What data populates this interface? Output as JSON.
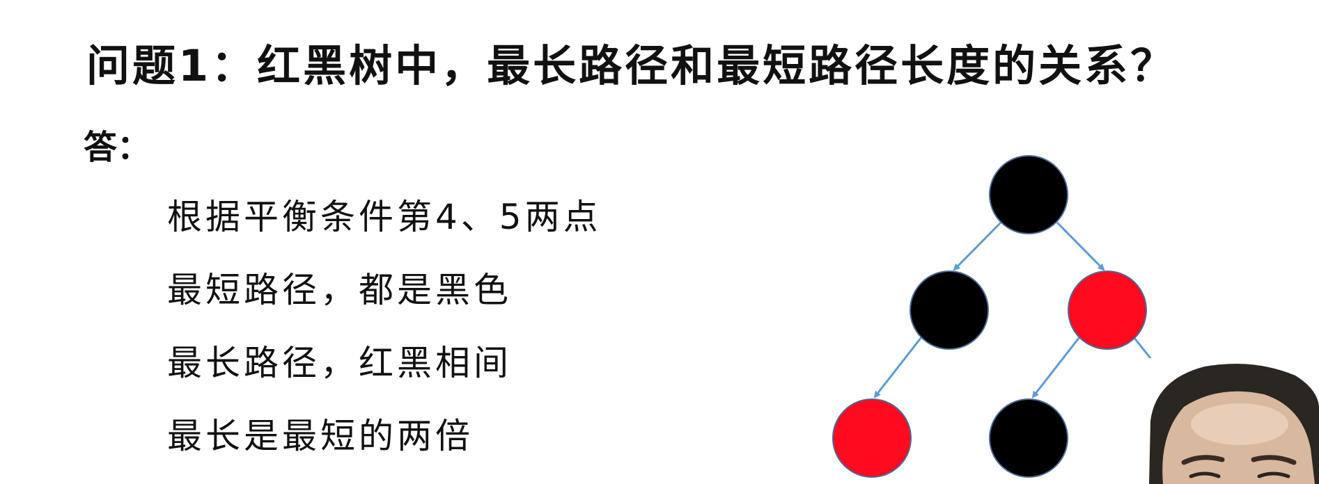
{
  "question": "问题1：红黑树中，最长路径和最短路径长度的关系？",
  "answer_label": "答：",
  "answer_lines": [
    "根据平衡条件第4、5两点",
    "最短路径，都是黑色",
    "最长路径，红黑相间",
    "最长是最短的两倍"
  ],
  "colors": {
    "black_node": "#000000",
    "red_node": "#ff0a1f",
    "edge": "#5b9bd5",
    "node_border": "#4a6a9a"
  },
  "tree_nodes": [
    {
      "id": "root",
      "color": "black"
    },
    {
      "id": "l",
      "color": "black"
    },
    {
      "id": "r",
      "color": "red"
    },
    {
      "id": "ll",
      "color": "red"
    },
    {
      "id": "rl",
      "color": "black"
    }
  ]
}
